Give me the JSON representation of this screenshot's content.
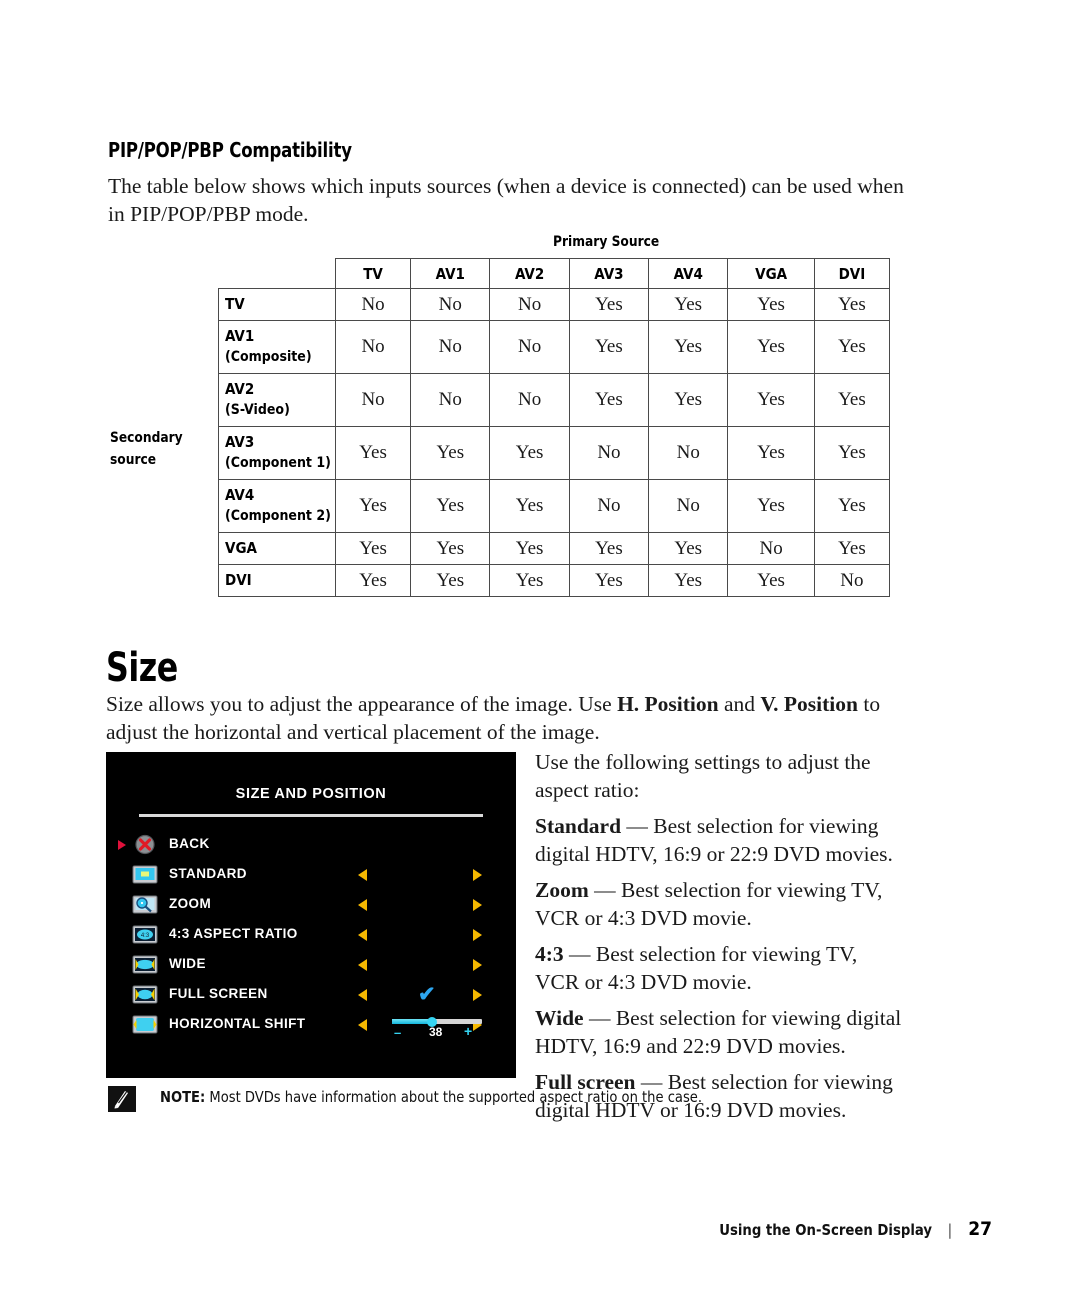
{
  "section": {
    "compat_heading": "PIP/POP/PBP Compatibility",
    "compat_intro": "The table below shows which inputs sources (when a device is connected) can be used when in PIP/POP/PBP mode.",
    "size_heading": "Size",
    "size_intro_1": "Size allows you to adjust the appearance of the image. Use ",
    "size_intro_bold_1": "H. Position",
    "size_intro_2": " and ",
    "size_intro_bold_2": "V. Position",
    "size_intro_3": " to adjust the horizontal and vertical placement of the image."
  },
  "table": {
    "primary_label": "Primary Source",
    "secondary_label": "Secondary source",
    "columns": [
      "TV",
      "AV1",
      "AV2",
      "AV3",
      "AV4",
      "VGA",
      "DVI"
    ],
    "rows": [
      {
        "label": "TV",
        "sub": "",
        "values": [
          "No",
          "No",
          "No",
          "Yes",
          "Yes",
          "Yes",
          "Yes"
        ]
      },
      {
        "label": "AV1",
        "sub": "(Composite)",
        "values": [
          "No",
          "No",
          "No",
          "Yes",
          "Yes",
          "Yes",
          "Yes"
        ]
      },
      {
        "label": "AV2",
        "sub": "(S-Video)",
        "values": [
          "No",
          "No",
          "No",
          "Yes",
          "Yes",
          "Yes",
          "Yes"
        ]
      },
      {
        "label": "AV3",
        "sub": "(Component 1)",
        "values": [
          "Yes",
          "Yes",
          "Yes",
          "No",
          "No",
          "Yes",
          "Yes"
        ]
      },
      {
        "label": "AV4",
        "sub": "(Component 2)",
        "values": [
          "Yes",
          "Yes",
          "Yes",
          "No",
          "No",
          "Yes",
          "Yes"
        ]
      },
      {
        "label": "VGA",
        "sub": "",
        "values": [
          "Yes",
          "Yes",
          "Yes",
          "Yes",
          "Yes",
          "No",
          "Yes"
        ]
      },
      {
        "label": "DVI",
        "sub": "",
        "values": [
          "Yes",
          "Yes",
          "Yes",
          "Yes",
          "Yes",
          "Yes",
          "No"
        ]
      }
    ]
  },
  "osd": {
    "title": "SIZE AND POSITION",
    "accent_arrow_color": "#f5b800",
    "pointer_color": "#e0113b",
    "check_color": "#2da6f0",
    "slider_color": "#35d4f2",
    "rows": [
      {
        "label": "BACK",
        "icon": "back-cancel-icon",
        "selected": true,
        "arrows": false,
        "check": false,
        "slider": false
      },
      {
        "label": "STANDARD",
        "icon": "standard-screen-icon",
        "selected": false,
        "arrows": true,
        "check": false,
        "slider": false
      },
      {
        "label": "ZOOM",
        "icon": "zoom-magnifier-icon",
        "selected": false,
        "arrows": true,
        "check": false,
        "slider": false
      },
      {
        "label": "4:3 ASPECT RATIO",
        "icon": "aspect-43-screen-icon",
        "selected": false,
        "arrows": true,
        "check": false,
        "slider": false
      },
      {
        "label": "WIDE",
        "icon": "wide-screen-icon",
        "selected": false,
        "arrows": true,
        "check": false,
        "slider": false
      },
      {
        "label": "FULL SCREEN",
        "icon": "fullscreen-icon",
        "selected": false,
        "arrows": true,
        "check": true,
        "slider": false
      },
      {
        "label": "HORIZONTAL SHIFT",
        "icon": "horizontal-shift-icon",
        "selected": false,
        "arrows": true,
        "check": false,
        "slider": true
      }
    ],
    "slider": {
      "value": "38",
      "minus": "–",
      "plus": "+",
      "fill_percent": 43
    }
  },
  "aspect_help": {
    "intro": "Use the following settings to adjust the aspect ratio:",
    "items": [
      {
        "term": "Standard",
        "desc": " — Best selection for viewing digital HDTV, 16:9 or 22:9 DVD movies."
      },
      {
        "term": "Zoom",
        "desc": " — Best selection for viewing TV, VCR or 4:3 DVD movie."
      },
      {
        "term": "4:3",
        "desc": " — Best selection for viewing TV, VCR or 4:3 DVD movie."
      },
      {
        "term": "Wide",
        "desc": " — Best selection for viewing digital HDTV, 16:9 and 22:9 DVD movies."
      },
      {
        "term": "Full screen",
        "desc": " — Best selection for viewing digital HDTV or 16:9 DVD movies."
      }
    ]
  },
  "note": {
    "label": "NOTE:",
    "text": " Most DVDs have information about the supported aspect ratio on the case."
  },
  "footer": {
    "title": "Using the On-Screen Display",
    "separator": "|",
    "page": "27"
  }
}
